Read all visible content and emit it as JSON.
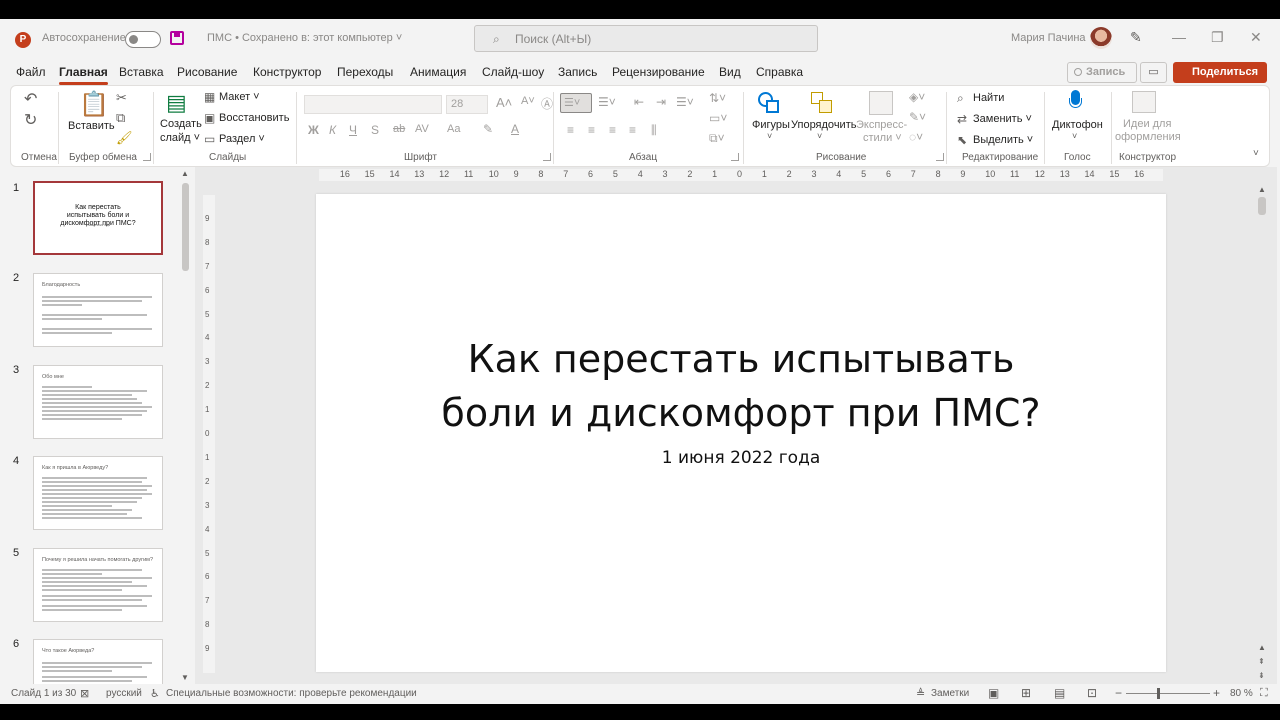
{
  "titlebar": {
    "autosave_label": "Автосохранение",
    "doc_title": "ПМС • Сохранено в: этот компьютер ˅",
    "search_placeholder": "Поиск (Alt+Ы)",
    "user_name": "Мария Пачина"
  },
  "menu": {
    "tabs": [
      "Файл",
      "Главная",
      "Вставка",
      "Рисование",
      "Конструктор",
      "Переходы",
      "Анимация",
      "Слайд-шоу",
      "Запись",
      "Рецензирование",
      "Вид",
      "Справка"
    ],
    "active": "Главная",
    "record_label": "Запись",
    "share_label": "Поделиться"
  },
  "ribbon": {
    "groups": {
      "undo": "Отмена",
      "clipboard": "Буфер обмена",
      "slides": "Слайды",
      "font": "Шрифт",
      "paragraph": "Абзац",
      "drawing": "Рисование",
      "editing": "Редактирование",
      "voice": "Голос",
      "designer": "Конструктор"
    },
    "paste_label": "Вставить",
    "new_slide_label_1": "Создать",
    "new_slide_label_2": "слайд ˅",
    "layout_label": "Макет ˅",
    "reset_label": "Восстановить",
    "section_label": "Раздел ˅",
    "font_size": "28",
    "shapes_label": "Фигуры",
    "arrange_label": "Упорядочить",
    "quick_styles_1": "Экспресс-",
    "quick_styles_2": "стили ˅",
    "find_label": "Найти",
    "replace_label": "Заменить ˅",
    "select_label": "Выделить ˅",
    "dictate_label": "Диктофон",
    "design_ideas_1": "Идеи для",
    "design_ideas_2": "оформления"
  },
  "thumbnails": [
    {
      "num": "1",
      "title": "Как перестать испытывать боли и дискомфорт при ПМС?",
      "sub": "1 июня 2022 года"
    },
    {
      "num": "2",
      "title": "Благодарность"
    },
    {
      "num": "3",
      "title": "Обо мне"
    },
    {
      "num": "4",
      "title": "Как я пришла в Аюрведу?"
    },
    {
      "num": "5",
      "title": "Почему я решила начать помогать другим?"
    },
    {
      "num": "6",
      "title": "Что такое Аюрведа?"
    }
  ],
  "ruler_h": [
    "16",
    "15",
    "14",
    "13",
    "12",
    "11",
    "10",
    "9",
    "8",
    "7",
    "6",
    "5",
    "4",
    "3",
    "2",
    "1",
    "0",
    "1",
    "2",
    "3",
    "4",
    "5",
    "6",
    "7",
    "8",
    "9",
    "10",
    "11",
    "12",
    "13",
    "14",
    "15",
    "16"
  ],
  "ruler_v": [
    "9",
    "8",
    "7",
    "6",
    "5",
    "4",
    "3",
    "2",
    "1",
    "0",
    "1",
    "2",
    "3",
    "4",
    "5",
    "6",
    "7",
    "8",
    "9"
  ],
  "slide": {
    "title_line1": "Как перестать испытывать",
    "title_line2": "боли и дискомфорт при ПМС?",
    "subtitle": "1 июня 2022 года"
  },
  "status": {
    "slide_info": "Слайд 1 из 30",
    "language": "русский",
    "accessibility": "Специальные возможности: проверьте рекомендации",
    "notes": "Заметки",
    "zoom": "80 %"
  },
  "colors": {
    "accent": "#c43e1c",
    "selected_thumb": "#a4373a"
  }
}
